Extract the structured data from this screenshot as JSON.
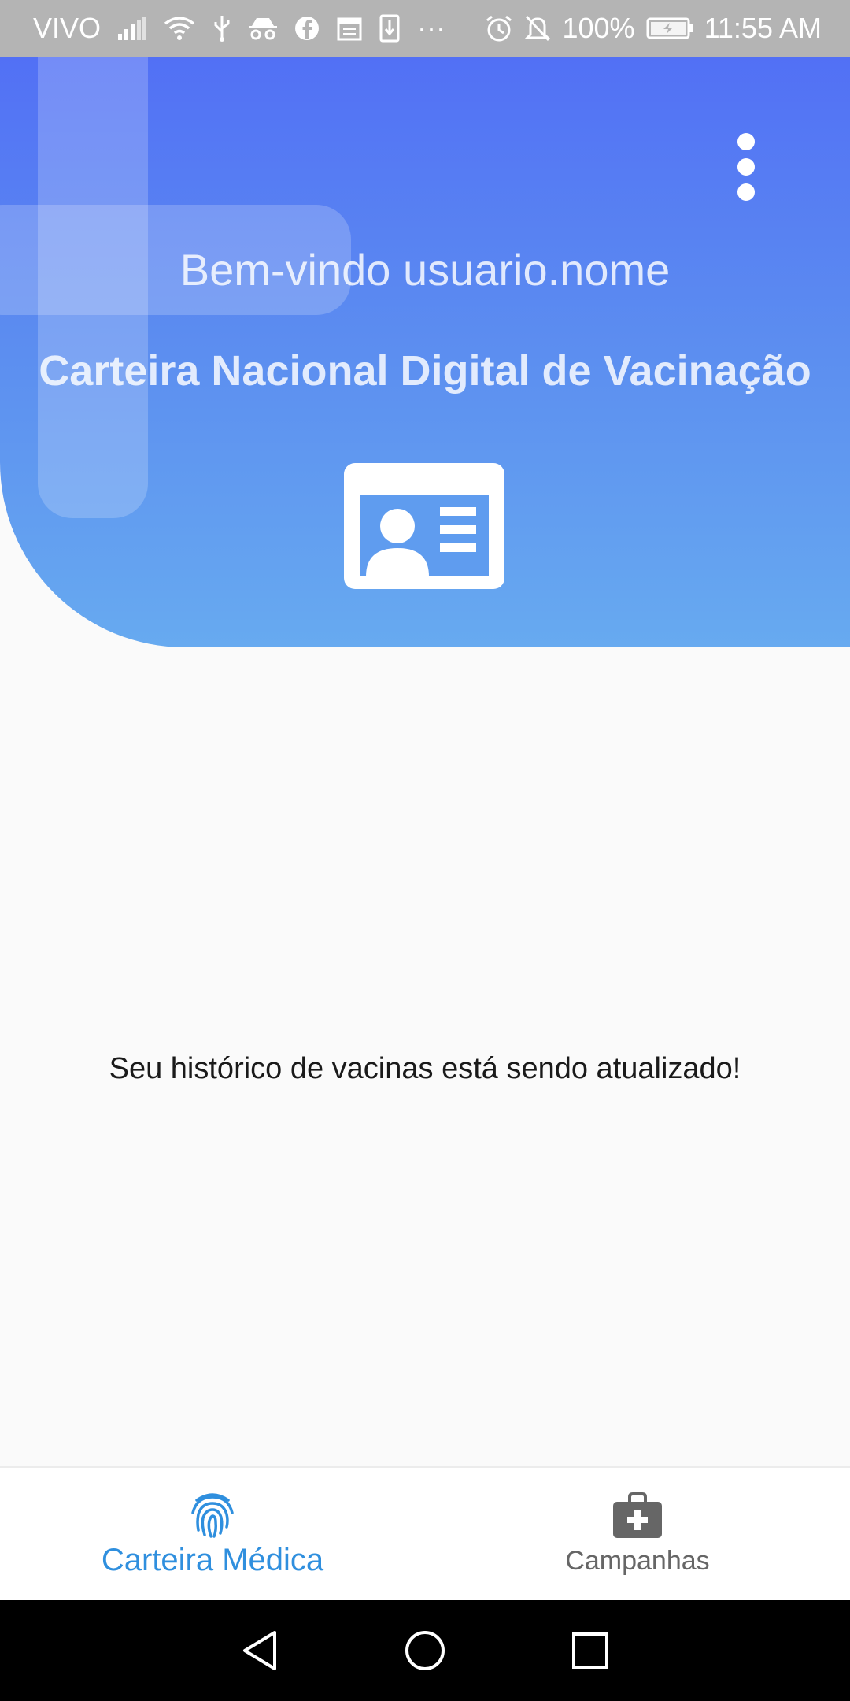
{
  "status_bar": {
    "carrier": "VIVO",
    "battery_percent": "100%",
    "time": "11:55 AM",
    "overflow": "···",
    "icons": [
      "signal-icon",
      "wifi-icon",
      "usb-icon",
      "incognito-icon",
      "facebook-icon",
      "calendar-icon",
      "download-icon",
      "alarm-icon",
      "mute-icon",
      "battery-icon"
    ]
  },
  "header": {
    "welcome_text": "Bem-vindo usuario.nome",
    "title": "Carteira Nacional Digital de Vacinação",
    "gradient_top": "#5270f5",
    "gradient_bottom": "#67aaf0",
    "menu_icon": "more-vert-icon",
    "card_icon": "id-card-icon"
  },
  "main": {
    "message": "Seu histórico de vacinas está sendo atualizado!"
  },
  "bottom_nav": {
    "tabs": [
      {
        "label": "Carteira Médica",
        "icon": "fingerprint-icon",
        "active": true
      },
      {
        "label": "Campanhas",
        "icon": "medical-bag-icon",
        "active": false
      }
    ],
    "active_color": "#2f8fde",
    "inactive_color": "#666666"
  },
  "system_nav": {
    "buttons": [
      "back-icon",
      "home-icon",
      "recents-icon"
    ]
  }
}
